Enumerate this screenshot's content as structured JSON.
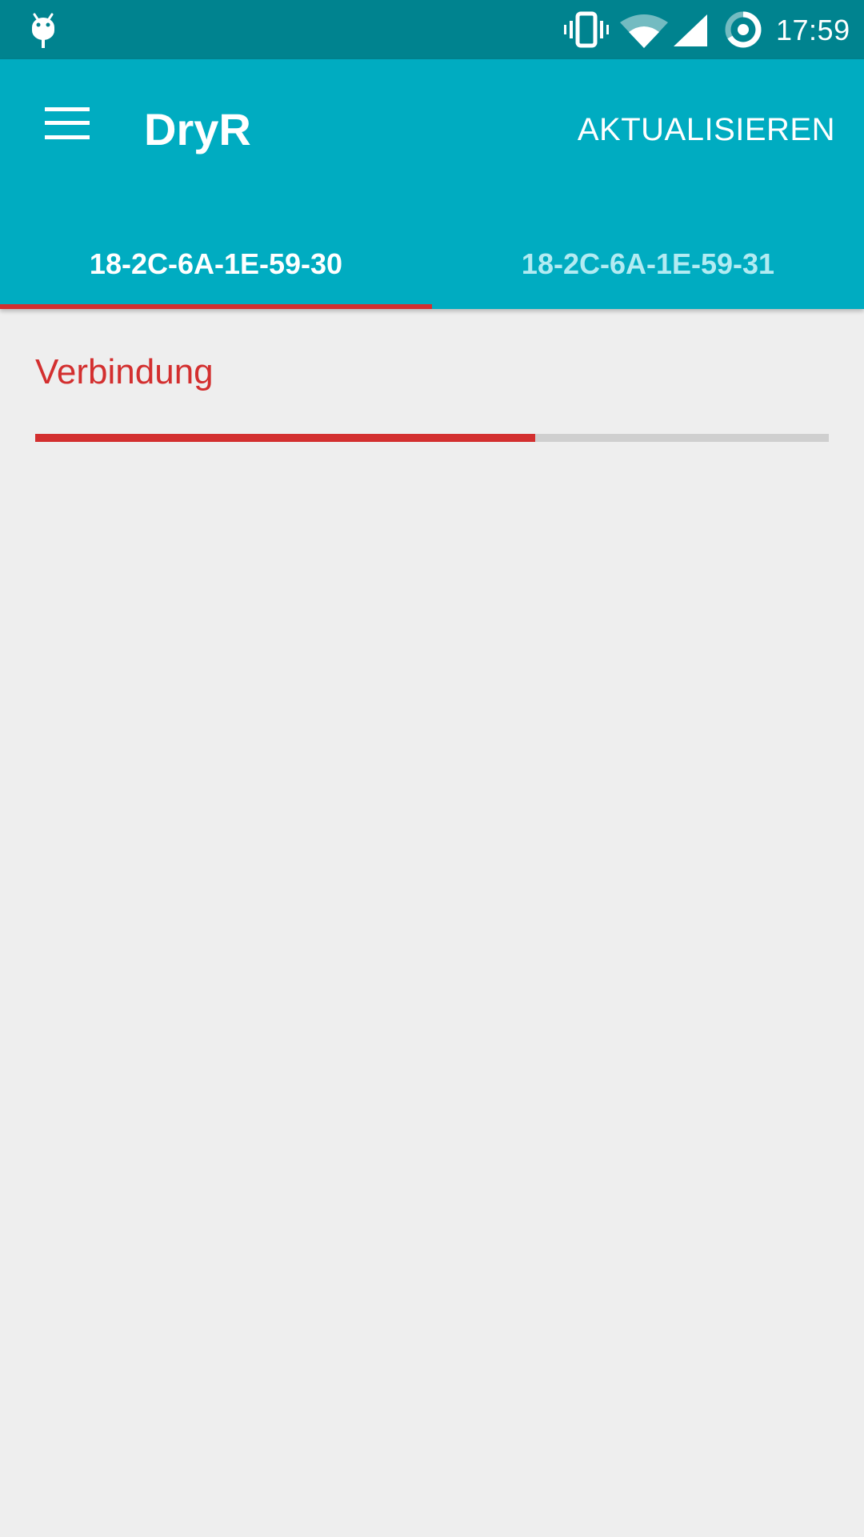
{
  "status_bar": {
    "time": "17:59",
    "icons": [
      "debug-icon",
      "vibrate-icon",
      "wifi-icon",
      "signal-icon",
      "battery-saver-icon"
    ]
  },
  "app_bar": {
    "menu_icon": "hamburger-menu-icon",
    "title": "DryR",
    "action_label": "AKTUALISIEREN"
  },
  "tabs": [
    {
      "label": "18-2C-6A-1E-59-30",
      "selected": true
    },
    {
      "label": "18-2C-6A-1E-59-31",
      "selected": false
    }
  ],
  "content": {
    "connection_label": "Verbindung",
    "connection_progress": 0.63
  },
  "colors": {
    "status_bar": "#00838f",
    "app_bar": "#00acc1",
    "accent": "#d32f2f",
    "background": "#eeeeee",
    "track": "#cfcfcf"
  }
}
